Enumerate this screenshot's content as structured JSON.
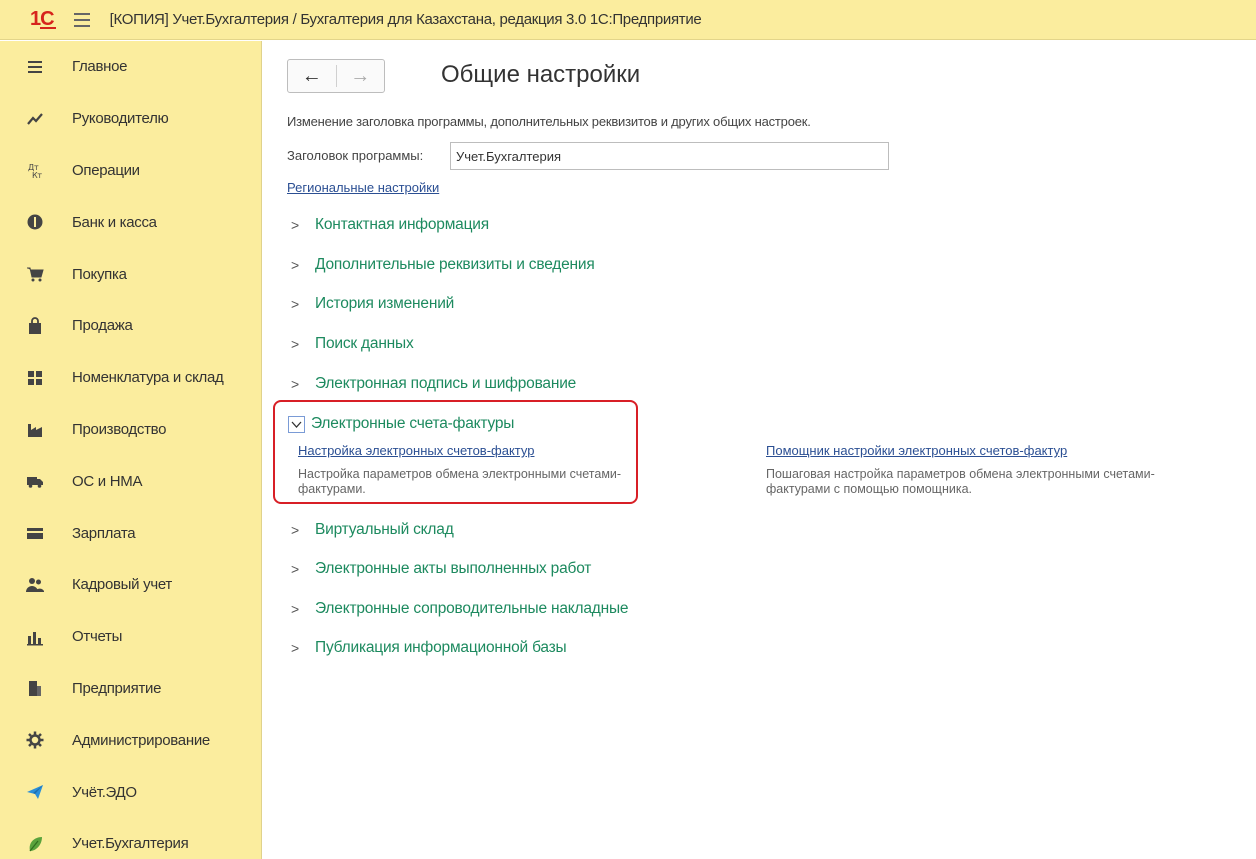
{
  "window": {
    "logo_text": "1С",
    "title": "[КОПИЯ] Учет.Бухгалтерия / Бухгалтерия для Казахстана, редакция 3.0 1С:Предприятие"
  },
  "sidebar": {
    "items": [
      {
        "label": "Главное",
        "icon": "menu-lines-icon"
      },
      {
        "label": "Руководителю",
        "icon": "trend-chart-icon"
      },
      {
        "label": "Операции",
        "icon": "debit-credit-icon"
      },
      {
        "label": "Банк и касса",
        "icon": "coin-icon"
      },
      {
        "label": "Покупка",
        "icon": "cart-icon"
      },
      {
        "label": "Продажа",
        "icon": "shopping-bag-icon"
      },
      {
        "label": "Номенклатура и склад",
        "icon": "warehouse-grid-icon"
      },
      {
        "label": "Производство",
        "icon": "factory-icon"
      },
      {
        "label": "ОС и НМА",
        "icon": "truck-icon"
      },
      {
        "label": "Зарплата",
        "icon": "wallet-icon"
      },
      {
        "label": "Кадровый учет",
        "icon": "people-icon"
      },
      {
        "label": "Отчеты",
        "icon": "bar-chart-icon"
      },
      {
        "label": "Предприятие",
        "icon": "building-icon"
      },
      {
        "label": "Администрирование",
        "icon": "gear-icon"
      },
      {
        "label": "Учёт.ЭДО",
        "icon": "paper-plane-icon"
      },
      {
        "label": "Учет.Бухгалтерия",
        "icon": "leaf-icon"
      }
    ]
  },
  "main": {
    "nav": {
      "back": "←",
      "forward": "→"
    },
    "title": "Общие настройки",
    "description": "Изменение заголовка программы, дополнительных реквизитов и других общих настроек.",
    "program_title_label": "Заголовок программы:",
    "program_title_value": "Учет.Бухгалтерия",
    "regional_settings_link": "Региональные настройки",
    "sections": [
      "Контактная информация",
      "Дополнительные реквизиты и сведения",
      "История изменений",
      "Поиск данных",
      "Электронная подпись и шифрование",
      "Электронные счета-фактуры",
      "Виртуальный склад",
      "Электронные акты выполненных работ",
      "Электронные сопроводительные накладные",
      "Публикация информационной базы"
    ],
    "expanded": {
      "link1": "Настройка электронных счетов-фактур",
      "desc1": "Настройка параметров обмена электронными счетами-фактурами.",
      "link2": "Помощник настройки электронных счетов-фактур",
      "desc2": "Пошаговая настройка параметров обмена электронными счетами-фактурами с помощью помощника."
    },
    "colors": {
      "section_green": "#1d8a5f",
      "link_blue": "#2b4f93",
      "highlight_red": "#d81f26",
      "panel_yellow": "#fbed9e"
    }
  }
}
